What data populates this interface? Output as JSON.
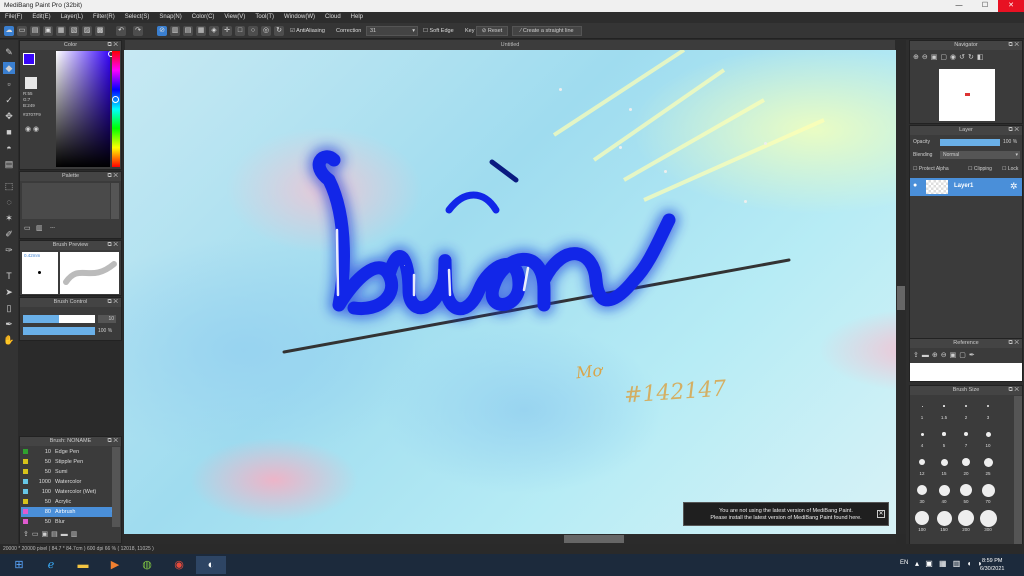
{
  "app": {
    "title": "MediBang Paint Pro (32bit)"
  },
  "menu": [
    "File(F)",
    "Edit(E)",
    "Layer(L)",
    "Filter(R)",
    "Select(S)",
    "Snap(N)",
    "Color(C)",
    "View(V)",
    "Tool(T)",
    "Window(W)",
    "Cloud",
    "Help"
  ],
  "toolbar": {
    "antialias_label": "AntiAliasing",
    "correction_label": "Correction",
    "correction_value": "31",
    "soft_edge_label": "Soft Edge",
    "key_label": "Key",
    "reset_label": "Reset",
    "straight_line_label": "Create a straight line"
  },
  "doc_tab": "Untitled",
  "color_panel": {
    "title": "Color",
    "r": "R:55",
    "g": "G:7",
    "b": "B:249",
    "hex": "#3707F9",
    "fg": "#3707F9",
    "bg": "#ffffff"
  },
  "palette_panel": {
    "title": "Palette",
    "dash": "---"
  },
  "brush_preview": {
    "title": "Brush Preview",
    "size": "0.42mm"
  },
  "brush_control": {
    "title": "Brush Control",
    "size_value": "10",
    "opacity_value": "100 %",
    "size_fraction": 0.5,
    "opacity_fraction": 1.0
  },
  "brush_list": {
    "title": "Brush: NONAME",
    "items": [
      {
        "size": "10",
        "name": "Edge Pen",
        "color": "#2fa02f",
        "selected": false
      },
      {
        "size": "50",
        "name": "Stipple Pen",
        "color": "#d6c21a",
        "selected": false
      },
      {
        "size": "50",
        "name": "Sumi",
        "color": "#d6c21a",
        "selected": false
      },
      {
        "size": "1000",
        "name": "Watercolor",
        "color": "#66c7e8",
        "selected": false
      },
      {
        "size": "100",
        "name": "Watercolor (Wet)",
        "color": "#66c7e8",
        "selected": false
      },
      {
        "size": "50",
        "name": "Acrylic",
        "color": "#d6c21a",
        "selected": false
      },
      {
        "size": "80",
        "name": "Airbrush",
        "color": "#e05ad0",
        "selected": true
      },
      {
        "size": "50",
        "name": "Blur",
        "color": "#e05ad0",
        "selected": false
      }
    ]
  },
  "navigator": {
    "title": "Navigator"
  },
  "layer_panel": {
    "title": "Layer",
    "opacity_label": "Opacity",
    "opacity_value": "100 %",
    "opacity_fraction": 1.0,
    "blending_label": "Blending",
    "blending_value": "Normal",
    "protect_alpha": "Protect Alpha",
    "clipping": "Clipping",
    "lock": "Lock",
    "layer_name": "Layer1"
  },
  "reference_panel": {
    "title": "Reference"
  },
  "brush_size_panel": {
    "title": "Brush Size",
    "labels": [
      "1",
      "1.5",
      "2",
      "3",
      "4",
      "5",
      "7",
      "10",
      "12",
      "15",
      "20",
      "25",
      "30",
      "40",
      "50",
      "70",
      "100",
      "150",
      "200",
      "300"
    ]
  },
  "canvas_art": {
    "word": "buồn",
    "signature": "Mơ",
    "number": "#142147"
  },
  "toast": {
    "line1": "You are not using the latest version of MediBang Paint.",
    "line2": "Please install the latest version of MediBang Paint found here."
  },
  "status": {
    "text": "20000 * 20000 pixel  ( 84.7 * 84.7cm )  600 dpi  66 %  ( 12018, 11025 )"
  },
  "taskbar": {
    "lang": "EN",
    "time": "8:59 PM",
    "date": "6/30/2021"
  }
}
